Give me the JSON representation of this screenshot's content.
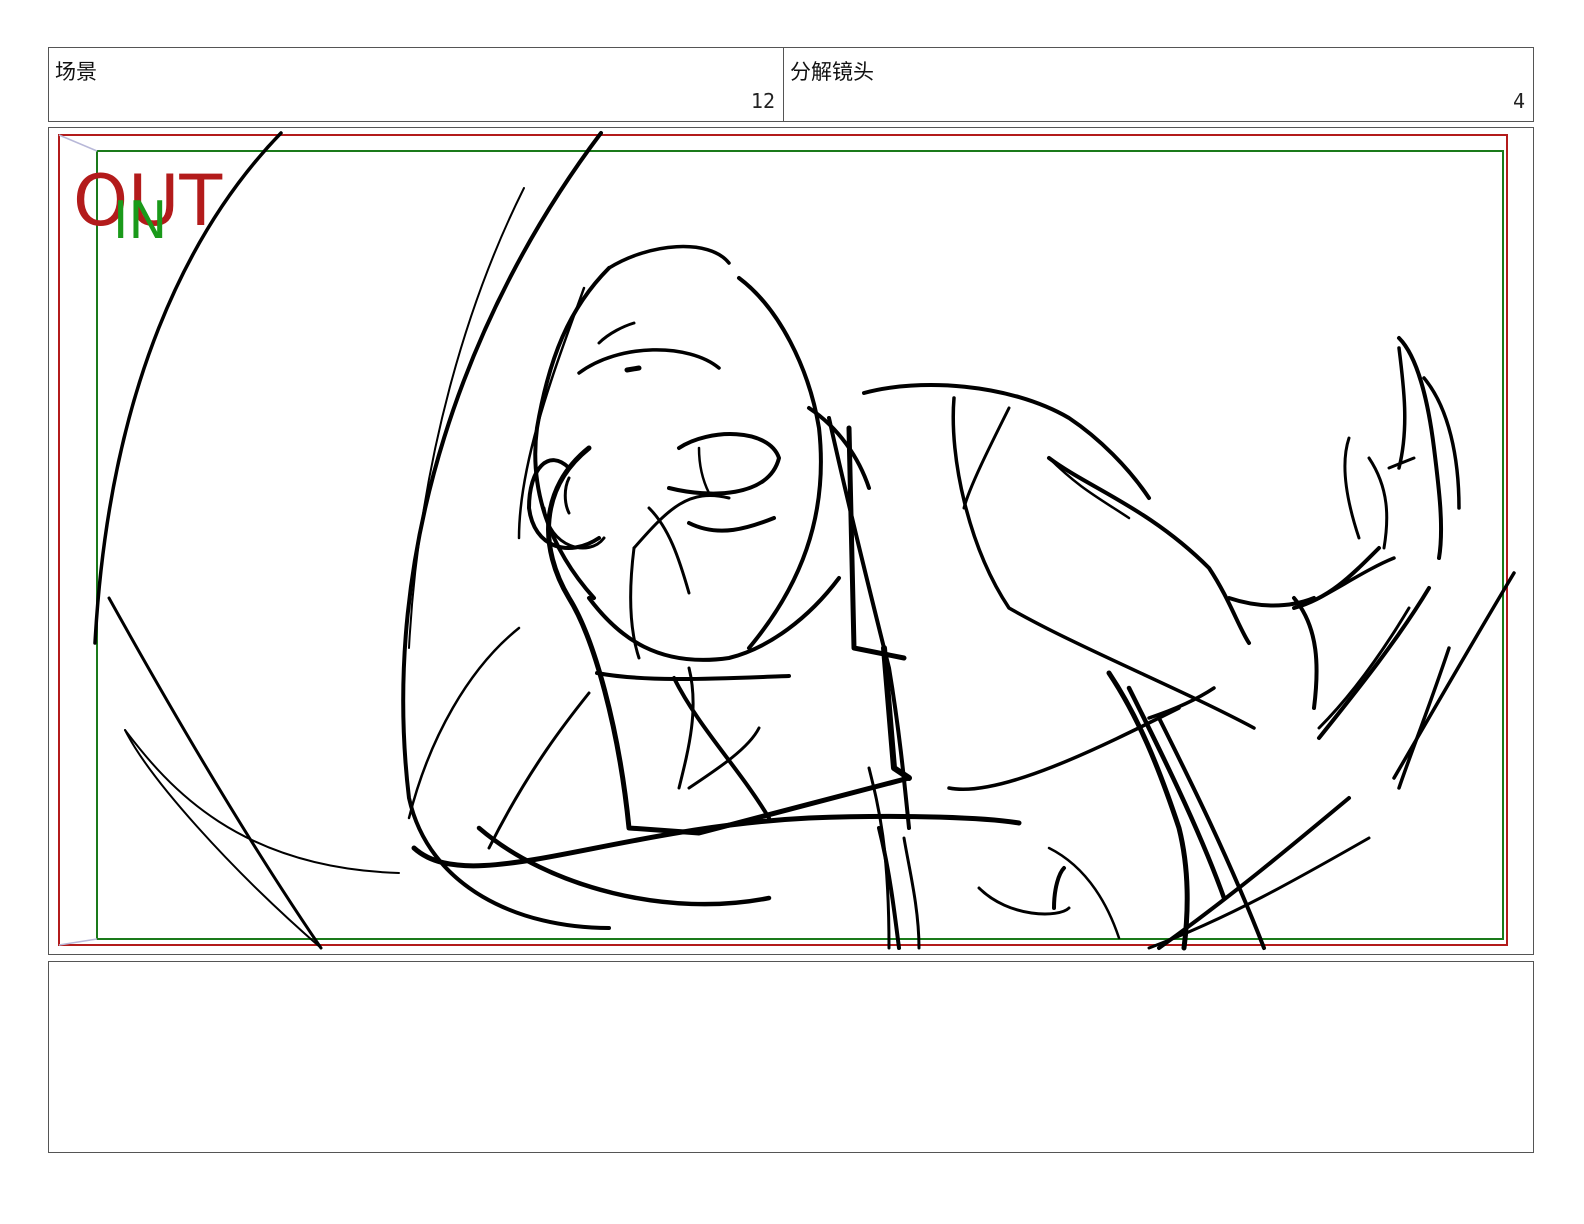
{
  "header": {
    "scene_label": "场景",
    "scene_number": "12",
    "shot_label": "分解镜头",
    "shot_number": "4"
  },
  "frame": {
    "out_label": "OUT",
    "in_label": "IN",
    "out_color": "#b31b1b",
    "in_color": "#1a9a1a"
  },
  "notes": {
    "text": ""
  }
}
